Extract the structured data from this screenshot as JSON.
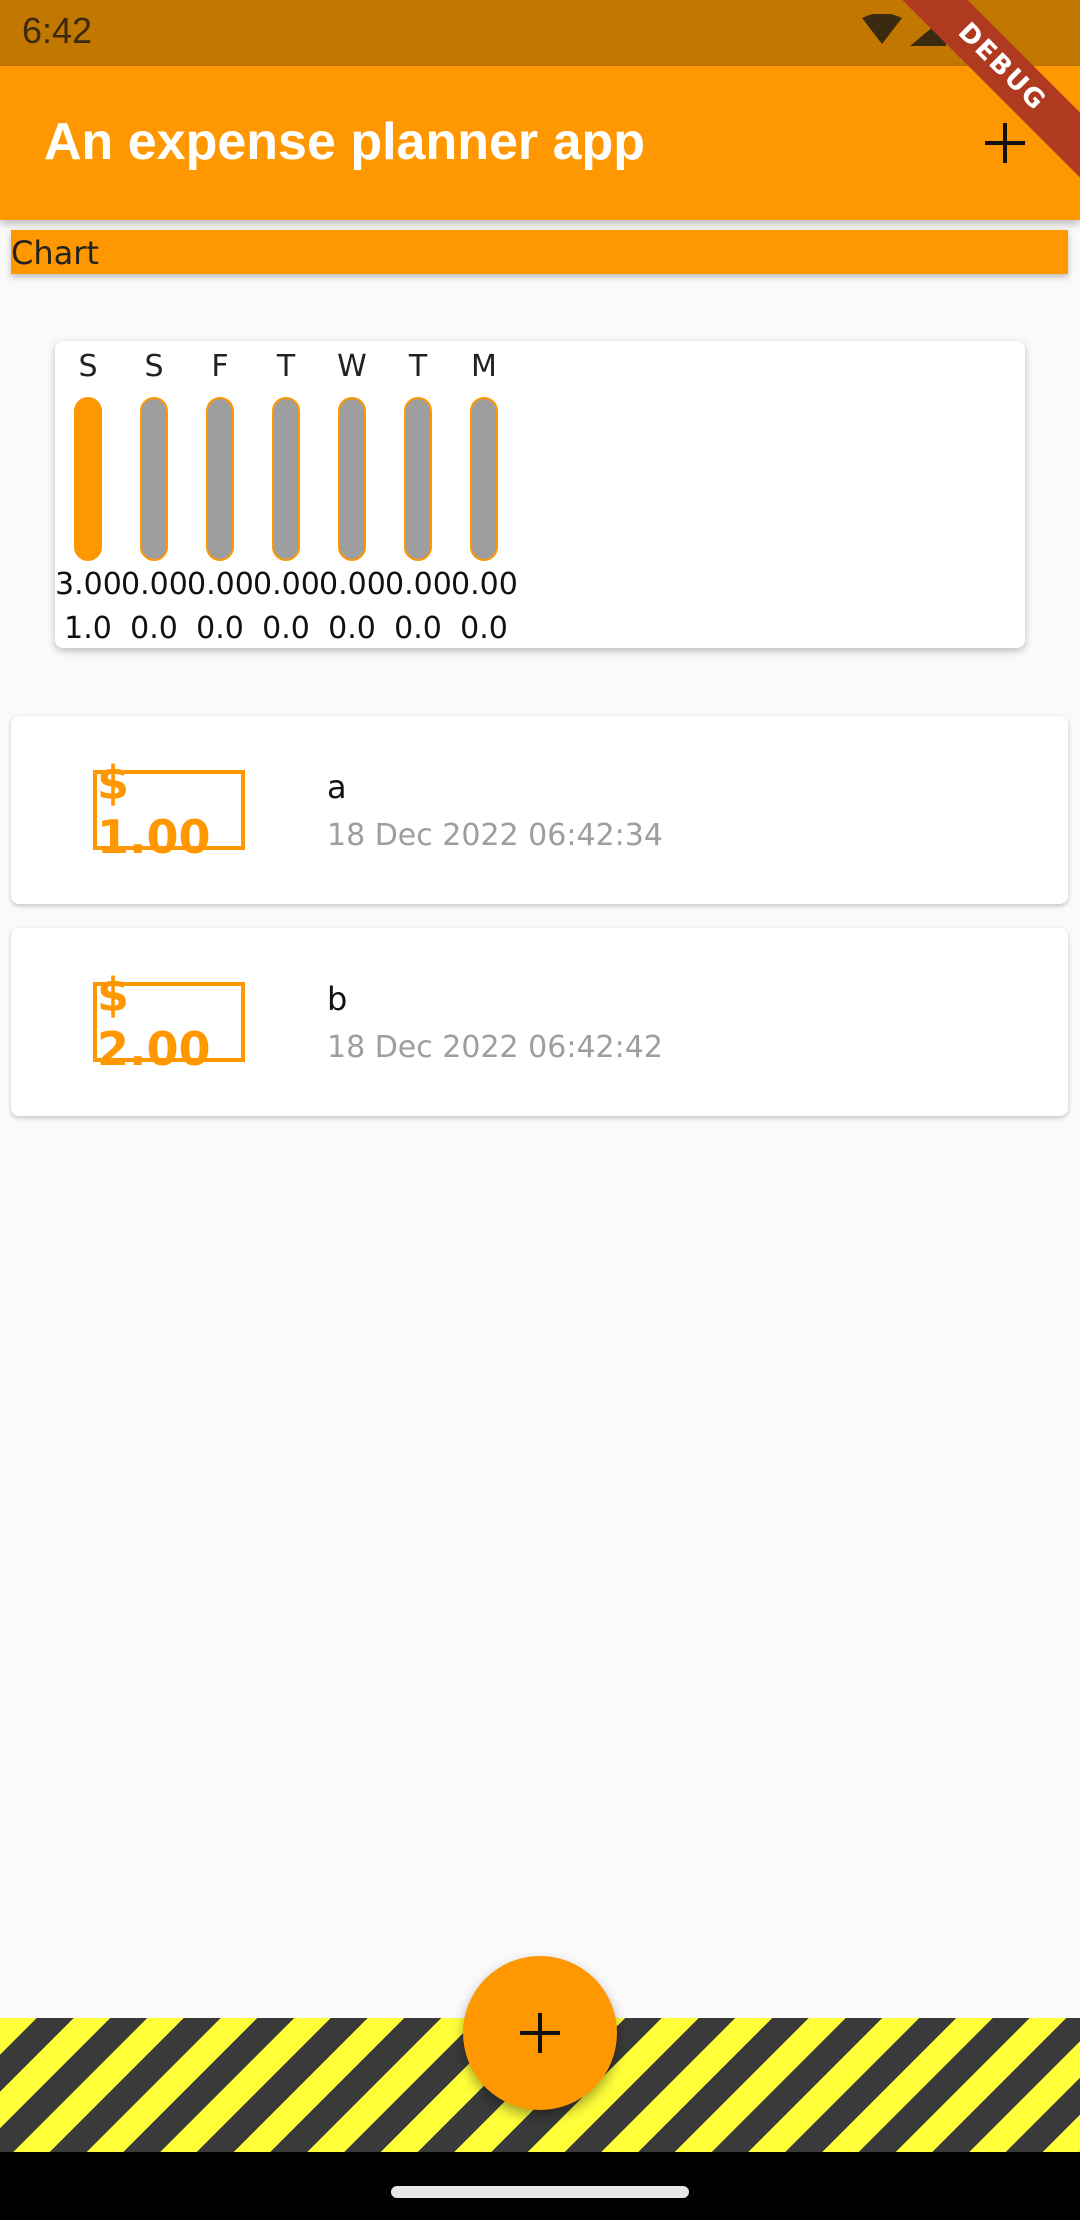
{
  "status_bar": {
    "time": "6:42",
    "icons": [
      "wifi-icon",
      "cell-signal-icon"
    ]
  },
  "app_bar": {
    "title": "An expense planner app",
    "add_icon": "plus-icon",
    "debug_label": "DEBUG"
  },
  "chart_header": {
    "label": "Chart"
  },
  "chart_data": {
    "type": "bar",
    "categories": [
      "S",
      "S",
      "F",
      "T",
      "W",
      "T",
      "M"
    ],
    "values": [
      3.0,
      0.0,
      0.0,
      0.0,
      0.0,
      0.0,
      0.0
    ],
    "value_labels": [
      "3.00",
      "0.00",
      "0.00",
      "0.00",
      "0.00",
      "0.00",
      "0.00"
    ],
    "fractions": [
      1.0,
      0.0,
      0.0,
      0.0,
      0.0,
      0.0,
      0.0
    ],
    "fraction_labels": [
      "1.0",
      "0.0",
      "0.0",
      "0.0",
      "0.0",
      "0.0",
      "0.0"
    ],
    "colors": {
      "fill": "#ff9800",
      "track": "#9e9e9e"
    }
  },
  "transactions": [
    {
      "amount": "$ 1.00",
      "title": "a",
      "date": "18 Dec 2022 06:42:34"
    },
    {
      "amount": "$ 2.00",
      "title": "b",
      "date": "18 Dec 2022 06:42:42"
    }
  ],
  "fab": {
    "icon": "plus-icon"
  },
  "colors": {
    "primary": "#ff9800",
    "status_bar": "#c27700",
    "background": "#fafafa"
  }
}
